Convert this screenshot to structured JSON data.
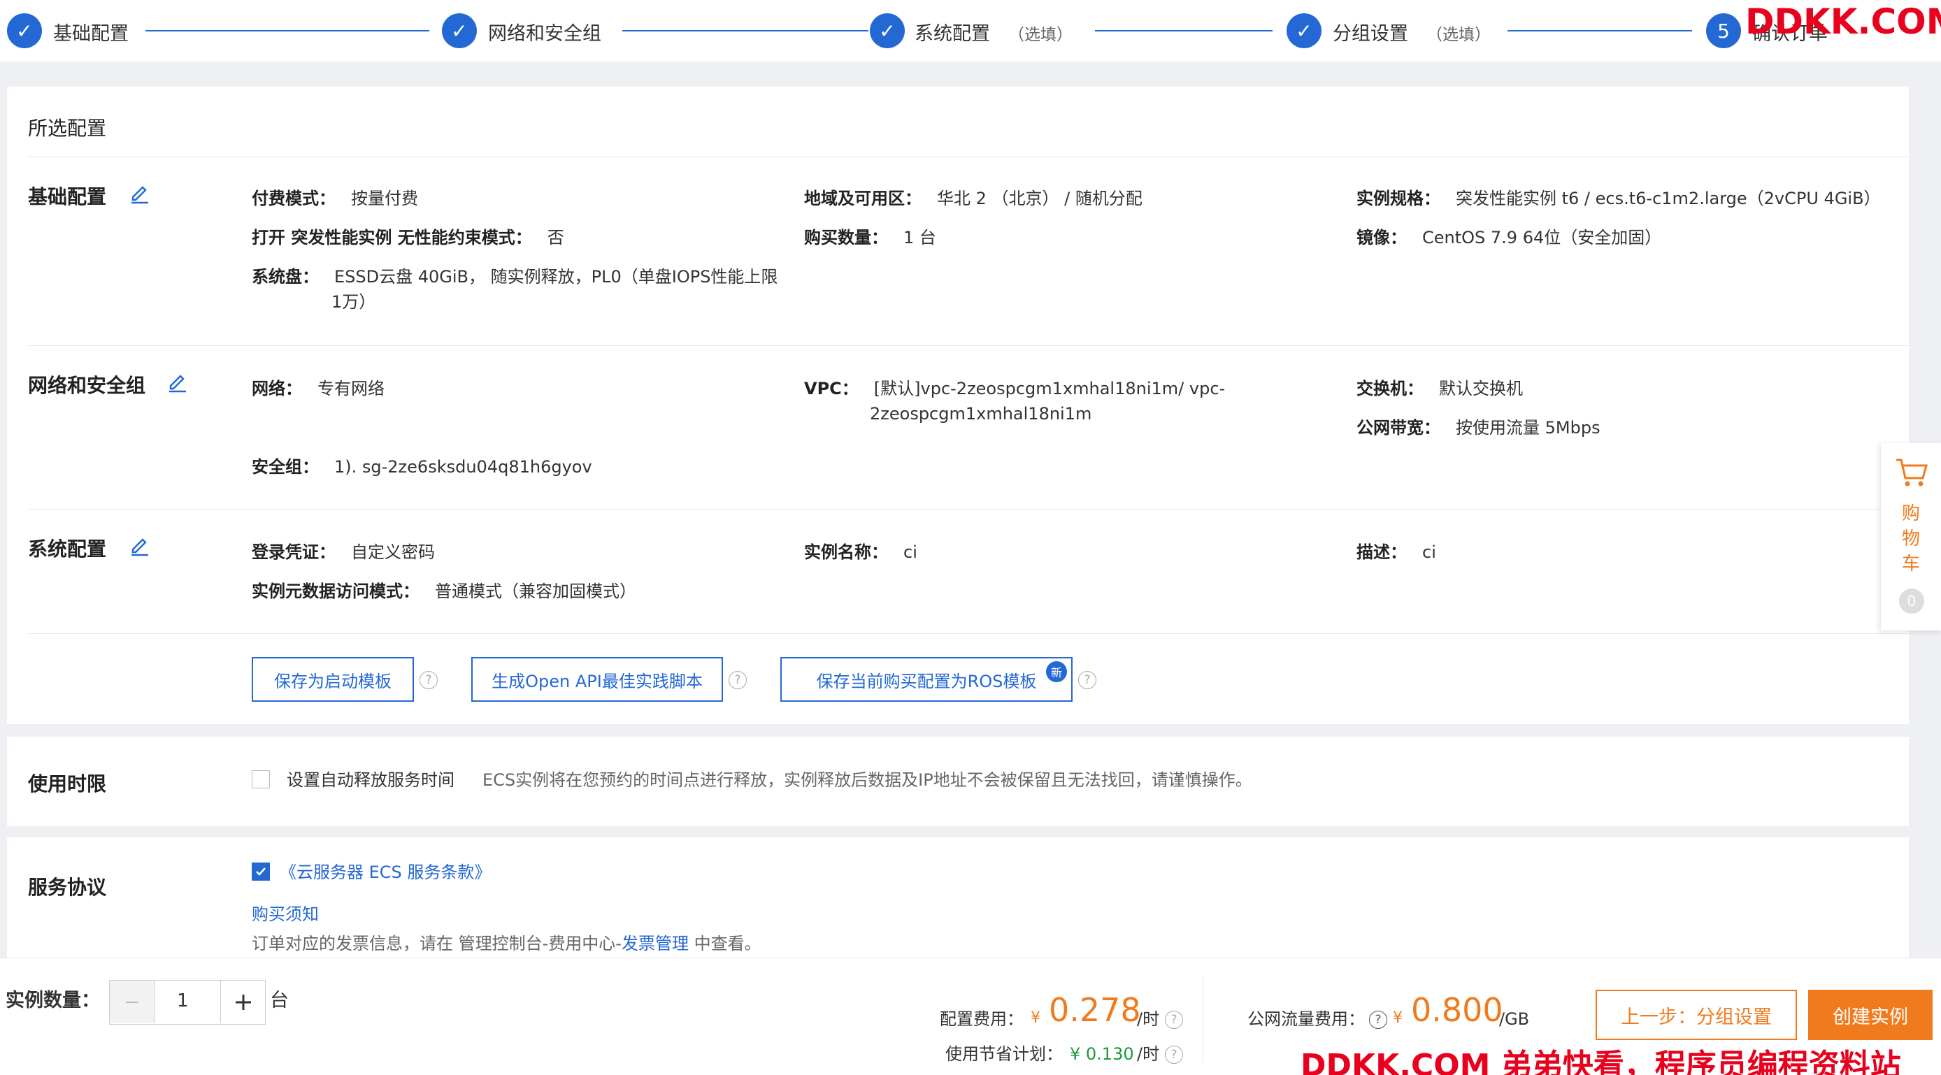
{
  "steps": [
    {
      "num": "✓",
      "label": "基础配置",
      "optional": ""
    },
    {
      "num": "✓",
      "label": "网络和安全组",
      "optional": ""
    },
    {
      "num": "✓",
      "label": "系统配置",
      "optional": "（选填）"
    },
    {
      "num": "✓",
      "label": "分组设置",
      "optional": "（选填）"
    },
    {
      "num": "5",
      "label": "确认订单",
      "optional": ""
    }
  ],
  "watermark_top": "DDKK.COM",
  "watermark_bottom": "DDKK.COM 弟弟快看，程序员编程资料站",
  "selected_title": "所选配置",
  "basic": {
    "title": "基础配置",
    "billing_label": "付费模式：",
    "billing_value": "按量付费",
    "burst_label": "打开 突发性能实例 无性能约束模式：",
    "burst_value": "否",
    "disk_label": "系统盘：",
    "disk_value_1": "ESSD云盘 40GiB， 随实例释放，PL0（单盘IOPS性能上限",
    "disk_value_2": "1万）",
    "region_label": "地域及可用区：",
    "region_value": "华北 2 （北京） / 随机分配",
    "qty_label": "购买数量：",
    "qty_value": "1 台",
    "spec_label": "实例规格：",
    "spec_value": "突发性能实例 t6 / ecs.t6-c1m2.large（2vCPU 4GiB）",
    "image_label": "镜像：",
    "image_value": "CentOS 7.9 64位（安全加固）"
  },
  "network": {
    "title": "网络和安全组",
    "net_label": "网络：",
    "net_value": "专有网络",
    "sg_label": "安全组：",
    "sg_value": "1). sg-2ze6sksdu04q81h6gyov",
    "vpc_label": "VPC：",
    "vpc_value_1": "[默认]vpc-2zeospcgm1xmhal18ni1m/ vpc-",
    "vpc_value_2": "2zeospcgm1xmhal18ni1m",
    "switch_label": "交换机：",
    "switch_value": "默认交换机",
    "bw_label": "公网带宽：",
    "bw_value": "按使用流量 5Mbps"
  },
  "system": {
    "title": "系统配置",
    "login_label": "登录凭证：",
    "login_value": "自定义密码",
    "meta_label": "实例元数据访问模式：",
    "meta_value": "普通模式（兼容加固模式）",
    "name_label": "实例名称：",
    "name_value": "ci",
    "desc_label": "描述：",
    "desc_value": "ci"
  },
  "actions": {
    "save_template": "保存为启动模板",
    "gen_api": "生成Open API最佳实践脚本",
    "save_ros": "保存当前购买配置为ROS模板",
    "new_badge": "新",
    "help": "?"
  },
  "duration": {
    "title": "使用时限",
    "checkbox_label": "设置自动释放服务时间",
    "hint": "ECS实例将在您预约的时间点进行释放，实例释放后数据及IP地址不会被保留且无法找回，请谨慎操作。"
  },
  "agreement": {
    "title": "服务协议",
    "terms": "《云服务器 ECS 服务条款》",
    "notice": "购买须知",
    "invoice_pre": "订单对应的发票信息，请在 管理控制台-费用中心-",
    "invoice_link": "发票管理",
    "invoice_post": " 中查看。"
  },
  "cart": {
    "label_1": "购",
    "label_2": "物",
    "label_3": "车",
    "count": "0"
  },
  "footer": {
    "qty_label": "实例数量：",
    "qty_value": "1",
    "qty_unit": "台",
    "config_fee_label": "配置费用：",
    "currency": "¥",
    "config_fee": "0.278",
    "per_hour": "/时",
    "saving_label": "使用节省计划：",
    "saving_fee": "¥ 0.130",
    "traffic_label": "公网流量费用：",
    "traffic_fee": "0.800",
    "per_gb": "/GB",
    "prev_button": "上一步：分组设置",
    "create_button": "创建实例"
  },
  "colors": {
    "accent": "#2468d4",
    "orange": "#f07b1e",
    "green": "#1a9a3a",
    "watermark": "#e8001c"
  }
}
